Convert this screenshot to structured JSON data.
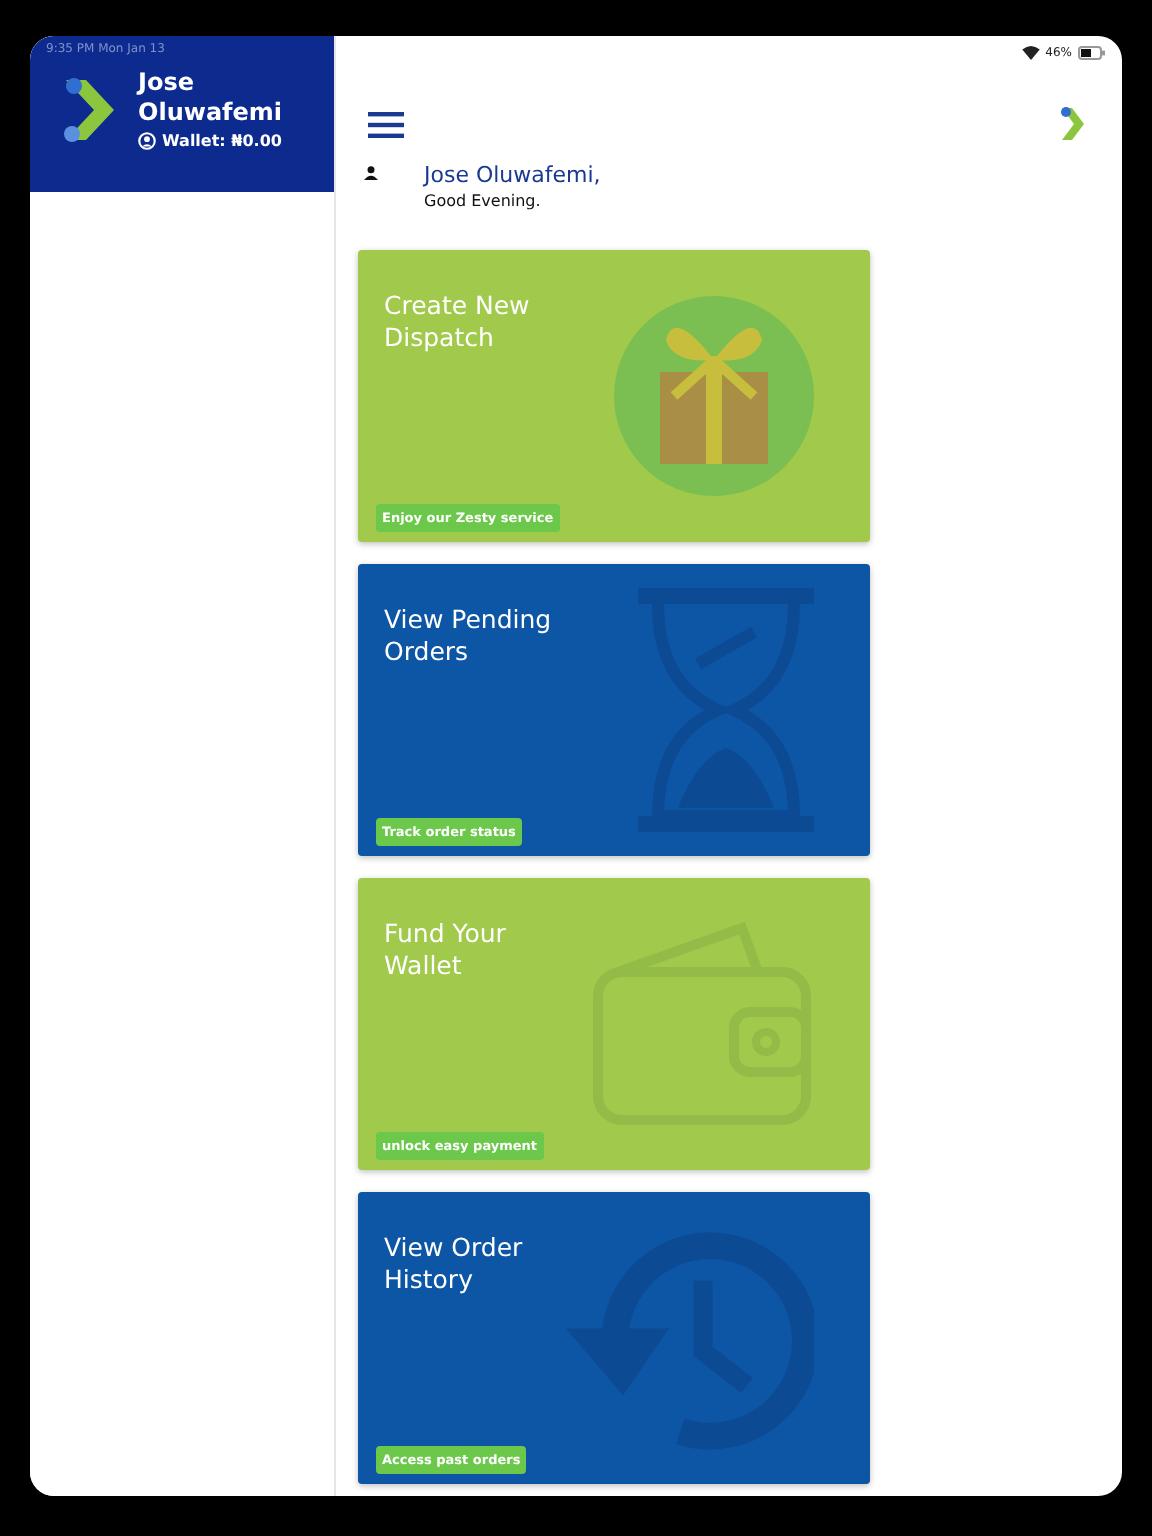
{
  "status_bar": {
    "time": "9:35 PM  Mon Jan 13",
    "battery": "46%"
  },
  "sidebar": {
    "name": "Jose Oluwafemi",
    "wallet": "Wallet: ₦0.00"
  },
  "greeting": {
    "name": "Jose Oluwafemi,",
    "message": "Good Evening."
  },
  "cards": [
    {
      "kind": "gift",
      "title": "Create New Dispatch",
      "tag": "Enjoy our Zesty service",
      "color": "#a1c94b"
    },
    {
      "kind": "hourglass",
      "title": "View Pending Orders",
      "tag": "Track order status",
      "color": "#0d55a5"
    },
    {
      "kind": "wallet",
      "title": "Fund Your Wallet",
      "tag": "unlock easy payment",
      "color": "#a1c94b"
    },
    {
      "kind": "history",
      "title": "View Order History",
      "tag": "Access past orders",
      "color": "#0d55a5"
    }
  ]
}
